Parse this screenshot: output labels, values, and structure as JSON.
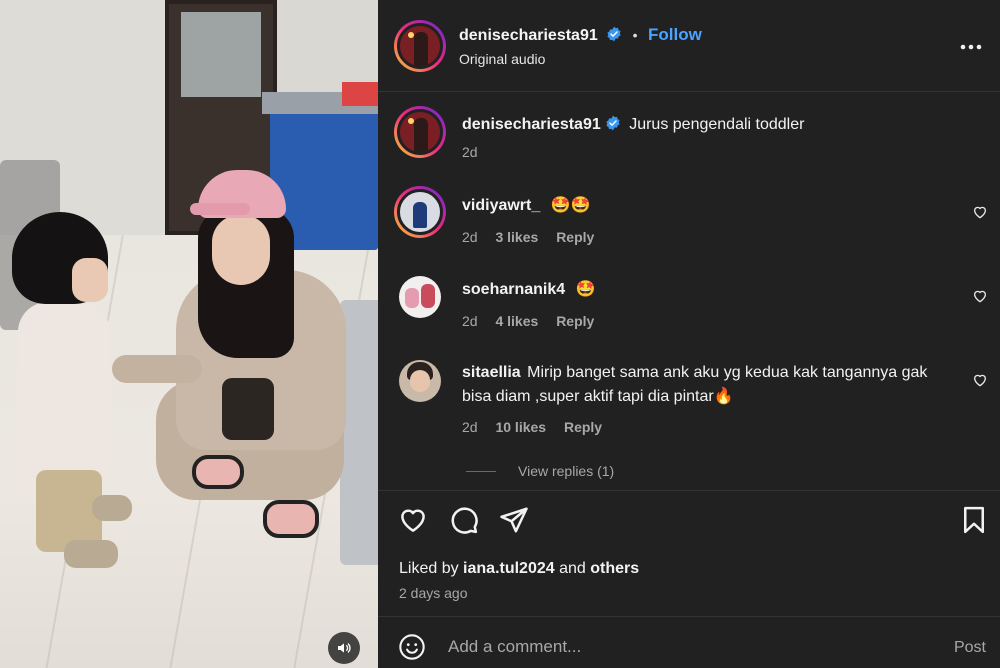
{
  "post": {
    "author": "denisechariesta91",
    "follow_label": "Follow",
    "separator": "•",
    "audio": "Original audio",
    "caption": "Jurus pengendali toddler",
    "caption_age": "2d"
  },
  "comments": [
    {
      "username": "vidiyawrt_",
      "text": "🤩🤩",
      "age": "2d",
      "likes": "3 likes",
      "reply": "Reply"
    },
    {
      "username": "soeharnanik4",
      "text": "🤩",
      "age": "2d",
      "likes": "4 likes",
      "reply": "Reply"
    },
    {
      "username": "sitaellia",
      "text": "Mirip banget sama ank aku yg kedua kak tangannya gak bisa diam ,super aktif tapi dia pintar🔥",
      "age": "2d",
      "likes": "10 likes",
      "reply": "Reply"
    }
  ],
  "view_replies": "View replies (1)",
  "engagement": {
    "liked_by_prefix": "Liked by ",
    "liked_by_user": "iana.tul2024",
    "liked_by_mid": " and ",
    "liked_by_others": "others",
    "post_date": "2 days ago"
  },
  "composer": {
    "placeholder": "Add a comment...",
    "post_label": "Post"
  },
  "icons": {
    "verified": "verified-badge-icon",
    "more": "more-options-icon",
    "like": "heart-icon",
    "comment": "comment-icon",
    "share": "share-icon",
    "save": "bookmark-icon",
    "emoji": "emoji-icon",
    "mute": "speaker-icon"
  },
  "colors": {
    "panel_bg": "#212121",
    "follow": "#4aa3ff",
    "verified": "#3897f0",
    "muted_text": "#a8a8a8"
  }
}
